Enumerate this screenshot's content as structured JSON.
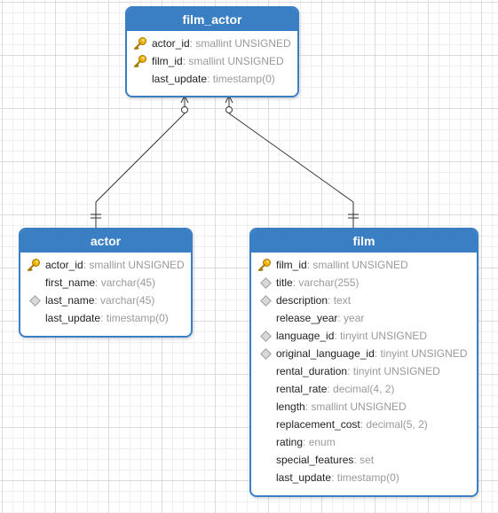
{
  "diagram": {
    "entities": {
      "film_actor": {
        "title": "film_actor",
        "fields": [
          {
            "name": "actor_id",
            "type": "smallint UNSIGNED",
            "marker": "key-icon"
          },
          {
            "name": "film_id",
            "type": "smallint UNSIGNED",
            "marker": "key-icon"
          },
          {
            "name": "last_update",
            "type": "timestamp(0)",
            "marker": "none"
          }
        ]
      },
      "actor": {
        "title": "actor",
        "fields": [
          {
            "name": "actor_id",
            "type": "smallint UNSIGNED",
            "marker": "key-icon"
          },
          {
            "name": "first_name",
            "type": "varchar(45)",
            "marker": "none"
          },
          {
            "name": "last_name",
            "type": "varchar(45)",
            "marker": "diamond-icon"
          },
          {
            "name": "last_update",
            "type": "timestamp(0)",
            "marker": "none"
          }
        ]
      },
      "film": {
        "title": "film",
        "fields": [
          {
            "name": "film_id",
            "type": "smallint UNSIGNED",
            "marker": "key-icon"
          },
          {
            "name": "title",
            "type": "varchar(255)",
            "marker": "diamond-icon"
          },
          {
            "name": "description",
            "type": "text",
            "marker": "diamond-icon"
          },
          {
            "name": "release_year",
            "type": "year",
            "marker": "none"
          },
          {
            "name": "language_id",
            "type": "tinyint UNSIGNED",
            "marker": "diamond-icon"
          },
          {
            "name": "original_language_id",
            "type": "tinyint UNSIGNED",
            "marker": "diamond-icon"
          },
          {
            "name": "rental_duration",
            "type": "tinyint UNSIGNED",
            "marker": "none"
          },
          {
            "name": "rental_rate",
            "type": "decimal(4, 2)",
            "marker": "none"
          },
          {
            "name": "length",
            "type": "smallint UNSIGNED",
            "marker": "none"
          },
          {
            "name": "replacement_cost",
            "type": "decimal(5, 2)",
            "marker": "none"
          },
          {
            "name": "rating",
            "type": "enum",
            "marker": "none"
          },
          {
            "name": "special_features",
            "type": "set",
            "marker": "none"
          },
          {
            "name": "last_update",
            "type": "timestamp(0)",
            "marker": "none"
          }
        ]
      }
    },
    "relationships": [
      {
        "from": "film_actor",
        "to": "actor",
        "from_cardinality": "zero-or-many",
        "to_cardinality": "exactly-one"
      },
      {
        "from": "film_actor",
        "to": "film",
        "from_cardinality": "zero-or-many",
        "to_cardinality": "exactly-one"
      }
    ],
    "colors": {
      "header": "#3a7fc4",
      "border": "#3a7fc4",
      "type_text": "#9a9a9a",
      "key": "#f2b200",
      "line": "#333333"
    }
  }
}
